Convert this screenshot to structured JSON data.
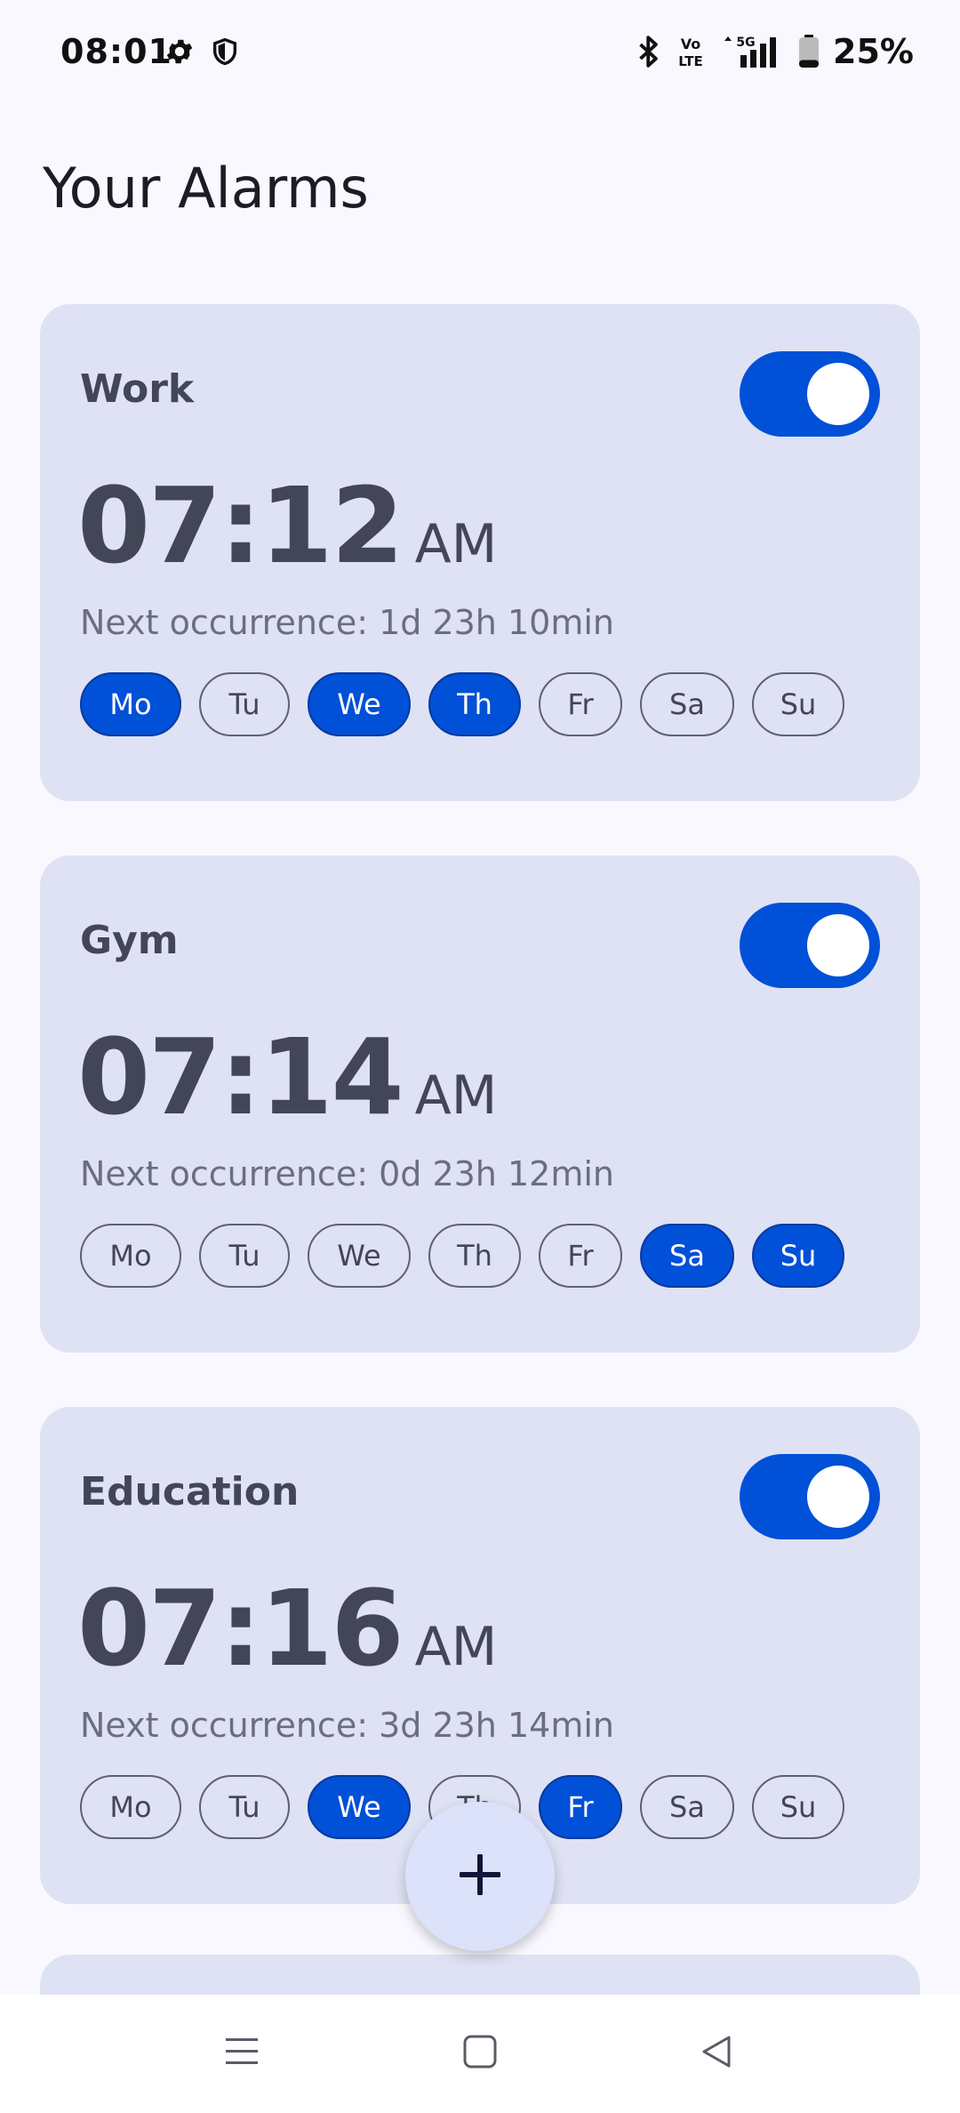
{
  "status_bar": {
    "time": "08:01",
    "battery_percent": "25%",
    "network_label": "5G",
    "volte_label_top": "Vo",
    "volte_label_bottom": "LTE",
    "icons": [
      "gear-icon",
      "shield-icon",
      "bluetooth-icon",
      "volte-icon",
      "signal-icon",
      "battery-icon"
    ],
    "battery_level": 0.25
  },
  "page": {
    "title": "Your Alarms"
  },
  "alarms": [
    {
      "label": "Work",
      "time": "07:12",
      "ampm": "AM",
      "next_occurrence": "Next occurrence: 1d 23h 10min",
      "enabled": true,
      "days": [
        {
          "label": "Mo",
          "selected": true
        },
        {
          "label": "Tu",
          "selected": false
        },
        {
          "label": "We",
          "selected": true
        },
        {
          "label": "Th",
          "selected": true
        },
        {
          "label": "Fr",
          "selected": false
        },
        {
          "label": "Sa",
          "selected": false
        },
        {
          "label": "Su",
          "selected": false
        }
      ]
    },
    {
      "label": "Gym",
      "time": "07:14",
      "ampm": "AM",
      "next_occurrence": "Next occurrence: 0d 23h 12min",
      "enabled": true,
      "days": [
        {
          "label": "Mo",
          "selected": false
        },
        {
          "label": "Tu",
          "selected": false
        },
        {
          "label": "We",
          "selected": false
        },
        {
          "label": "Th",
          "selected": false
        },
        {
          "label": "Fr",
          "selected": false
        },
        {
          "label": "Sa",
          "selected": true
        },
        {
          "label": "Su",
          "selected": true
        }
      ]
    },
    {
      "label": "Education",
      "time": "07:16",
      "ampm": "AM",
      "next_occurrence": "Next occurrence: 3d 23h 14min",
      "enabled": true,
      "days": [
        {
          "label": "Mo",
          "selected": false
        },
        {
          "label": "Tu",
          "selected": false
        },
        {
          "label": "We",
          "selected": true
        },
        {
          "label": "Th",
          "selected": false
        },
        {
          "label": "Fr",
          "selected": true
        },
        {
          "label": "Sa",
          "selected": false
        },
        {
          "label": "Su",
          "selected": false
        }
      ]
    }
  ],
  "fab": {
    "icon": "plus-icon"
  },
  "nav_bar": {
    "icons": [
      "menu-icon",
      "home-icon",
      "back-icon"
    ]
  },
  "colors": {
    "accent": "#0050d8",
    "card_background": "#dfe2f4",
    "page_background": "#f8f8fe",
    "text_muted": "#434656"
  }
}
